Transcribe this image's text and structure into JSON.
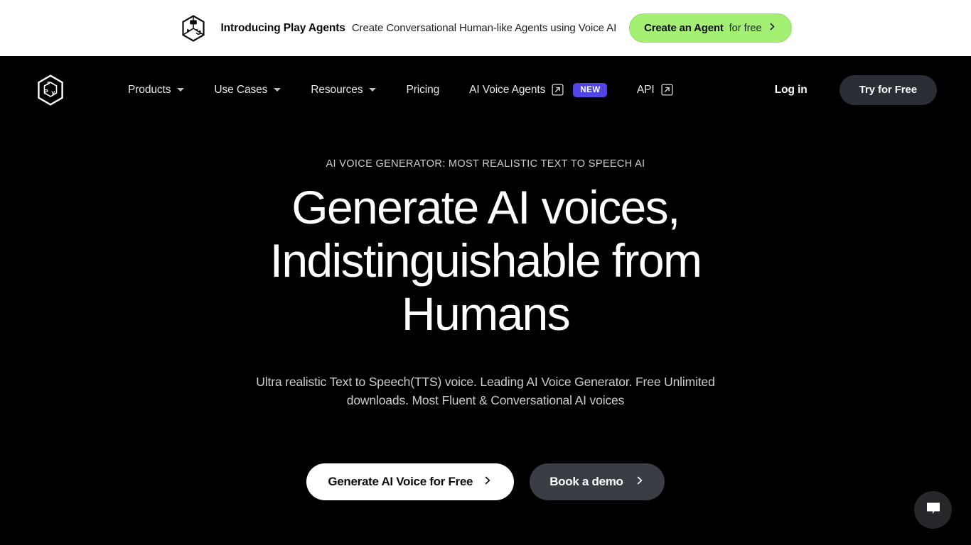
{
  "banner": {
    "logo_icon": "play-cube-logo-icon",
    "title": "Introducing Play Agents",
    "subtitle": "Create Conversational Human-like Agents using Voice AI",
    "cta_strong": "Create an Agent",
    "cta_light": "for free",
    "cta_chevron_icon": "chevron-right-icon",
    "background_color": "#ffffff",
    "cta_color": "#a3f075"
  },
  "nav": {
    "logo_icon": "play-ht-cube-logo-icon",
    "items": [
      {
        "label": "Products",
        "has_caret": true,
        "external": false,
        "badge": ""
      },
      {
        "label": "Use Cases",
        "has_caret": true,
        "external": false,
        "badge": ""
      },
      {
        "label": "Resources",
        "has_caret": true,
        "external": false,
        "badge": ""
      },
      {
        "label": "Pricing",
        "has_caret": false,
        "external": false,
        "badge": ""
      },
      {
        "label": "AI Voice Agents",
        "has_caret": false,
        "external": true,
        "badge": "NEW"
      },
      {
        "label": "API",
        "has_caret": false,
        "external": true,
        "badge": ""
      }
    ],
    "login_label": "Log in",
    "try_label": "Try for Free",
    "badge_color": "#4f46e5",
    "try_bg_color": "#2b2e34"
  },
  "hero": {
    "eyebrow": "AI VOICE GENERATOR: MOST REALISTIC TEXT TO SPEECH AI",
    "headline": "Generate AI voices, Indistinguishable from Humans",
    "subtitle": "Ultra realistic Text to Speech(TTS) voice. Leading AI Voice Generator. Free Unlimited downloads. Most Fluent & Conversational AI voices",
    "primary_cta": "Generate AI Voice for Free",
    "primary_cta_icon": "chevron-right-icon",
    "secondary_cta": "Book a demo",
    "secondary_cta_icon": "chevron-right-icon",
    "background_color": "#000000"
  },
  "chat": {
    "icon": "chat-bubble-icon",
    "background_color": "#25272b"
  }
}
